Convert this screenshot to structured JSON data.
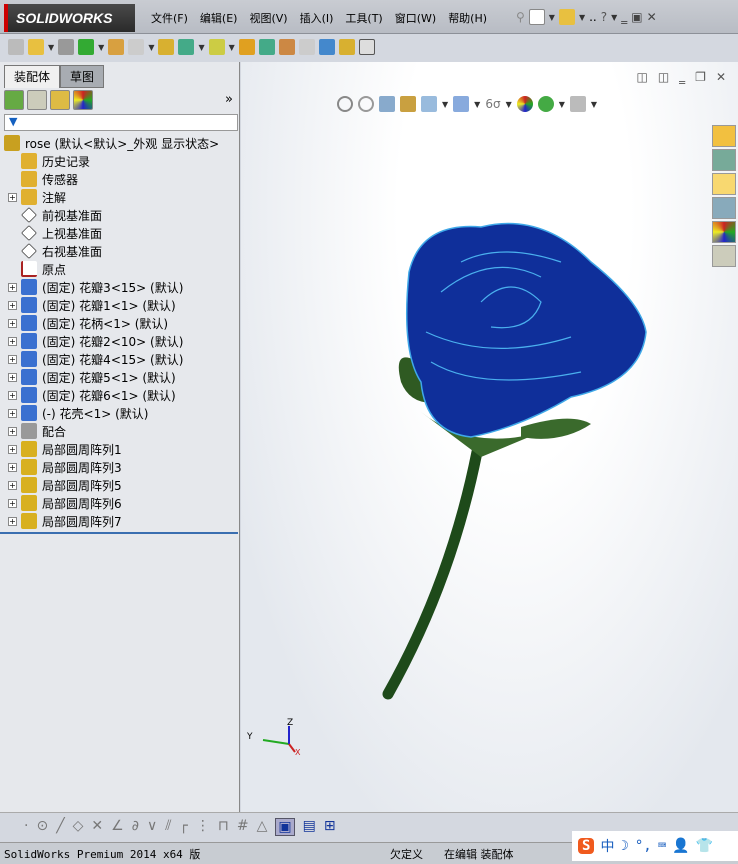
{
  "app": {
    "logo": "SOLIDWORKS"
  },
  "menu": [
    "文件(F)",
    "编辑(E)",
    "视图(V)",
    "插入(I)",
    "工具(T)",
    "窗口(W)",
    "帮助(H)"
  ],
  "panel": {
    "tabs": [
      "装配体",
      "草图"
    ],
    "more": "»",
    "filter": "▼"
  },
  "tree": [
    {
      "label": "rose  (默认<默认>_外观 显示状态>",
      "exp": false,
      "icon": "assembly",
      "c": "#c8a020"
    },
    {
      "label": "历史记录",
      "exp": false,
      "icon": "history",
      "c": "#e0b030"
    },
    {
      "label": "传感器",
      "exp": false,
      "icon": "sensor",
      "c": "#e0b030"
    },
    {
      "label": "注解",
      "exp": true,
      "icon": "annotation",
      "c": "#e0b030"
    },
    {
      "label": "前视基准面",
      "exp": false,
      "icon": "plane",
      "c": "#fff"
    },
    {
      "label": "上视基准面",
      "exp": false,
      "icon": "plane",
      "c": "#fff"
    },
    {
      "label": "右视基准面",
      "exp": false,
      "icon": "plane",
      "c": "#fff"
    },
    {
      "label": "原点",
      "exp": false,
      "icon": "origin",
      "c": "#fff"
    },
    {
      "label": "(固定) 花瓣3<15> (默认)",
      "exp": true,
      "icon": "part",
      "c": "#3a70d0"
    },
    {
      "label": "(固定) 花瓣1<1> (默认)",
      "exp": true,
      "icon": "part",
      "c": "#3a70d0"
    },
    {
      "label": "(固定) 花柄<1> (默认)",
      "exp": true,
      "icon": "part",
      "c": "#3a70d0"
    },
    {
      "label": "(固定) 花瓣2<10> (默认)",
      "exp": true,
      "icon": "part",
      "c": "#3a70d0"
    },
    {
      "label": "(固定) 花瓣4<15> (默认)",
      "exp": true,
      "icon": "part",
      "c": "#3a70d0"
    },
    {
      "label": "(固定) 花瓣5<1> (默认)",
      "exp": true,
      "icon": "part",
      "c": "#3a70d0"
    },
    {
      "label": "(固定) 花瓣6<1> (默认)",
      "exp": true,
      "icon": "part",
      "c": "#3a70d0"
    },
    {
      "label": "(-) 花壳<1> (默认)",
      "exp": true,
      "icon": "part",
      "c": "#3a70d0"
    },
    {
      "label": "配合",
      "exp": true,
      "icon": "mates",
      "c": "#999"
    },
    {
      "label": "局部圆周阵列1",
      "exp": true,
      "icon": "pattern",
      "c": "#d8b020"
    },
    {
      "label": "局部圆周阵列3",
      "exp": true,
      "icon": "pattern",
      "c": "#d8b020"
    },
    {
      "label": "局部圆周阵列5",
      "exp": true,
      "icon": "pattern",
      "c": "#d8b020"
    },
    {
      "label": "局部圆周阵列6",
      "exp": true,
      "icon": "pattern",
      "c": "#d8b020"
    },
    {
      "label": "局部圆周阵列7",
      "exp": true,
      "icon": "pattern",
      "c": "#d8b020"
    }
  ],
  "triad": {
    "x": "X",
    "y": "Y",
    "z": "Z"
  },
  "status": {
    "version": "SolidWorks Premium 2014 x64 版",
    "state": "欠定义",
    "mode": "在编辑 装配体"
  },
  "ime": {
    "lang": "中"
  }
}
